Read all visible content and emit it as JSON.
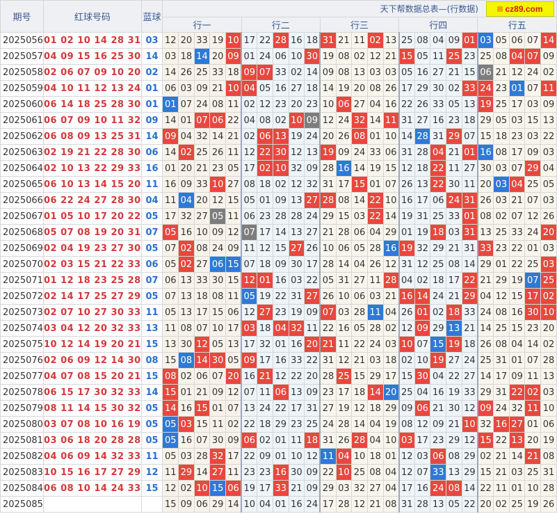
{
  "header": {
    "issue_label": "期号",
    "red_label": "红球号码",
    "blue_label": "蓝球",
    "banner": "天下帮数据总表—(行数据)",
    "logo_text": "cz89.com",
    "groups": [
      "行一",
      "行二",
      "行三",
      "行四",
      "行五"
    ]
  },
  "colors": {
    "red": "#e8473f",
    "blue": "#2f79d6",
    "gray": "#7d7d7d",
    "red_text": "#d03a3a",
    "blue_text": "#2a6fcb"
  },
  "rows": [
    {
      "issue": "2025056",
      "reds": "01 02 10 14 28 31",
      "blue": "03",
      "nums": [
        "12",
        "20",
        "33",
        "19",
        "10",
        "17",
        "22",
        "28",
        "16",
        "18",
        "31",
        "21",
        "11",
        "02",
        "13",
        "25",
        "08",
        "04",
        "09",
        "01",
        "03",
        "05",
        "06",
        "07",
        "14"
      ],
      "hl": "....R..R..R..R.....RB...R"
    },
    {
      "issue": "2025057",
      "reds": "04 09 15 16 25 30",
      "blue": "14",
      "nums": [
        "03",
        "18",
        "14",
        "20",
        "09",
        "01",
        "24",
        "06",
        "10",
        "30",
        "19",
        "08",
        "02",
        "12",
        "21",
        "15",
        "05",
        "11",
        "25",
        "23",
        "25",
        "08",
        "04",
        "07",
        "09"
      ],
      "hl": "..B.R....R.....R..R...RR."
    },
    {
      "issue": "2025058",
      "reds": "02 06 07 09 10 20",
      "blue": "02",
      "nums": [
        "14",
        "26",
        "25",
        "33",
        "18",
        "09",
        "07",
        "33",
        "02",
        "14",
        "09",
        "08",
        "13",
        "03",
        "03",
        "05",
        "16",
        "27",
        "21",
        "15",
        "06",
        "21",
        "12",
        "24",
        "02"
      ],
      "hl": ".....RR.............G...."
    },
    {
      "issue": "2025059",
      "reds": "04 10 11 12 13 24",
      "blue": "01",
      "nums": [
        "06",
        "03",
        "09",
        "21",
        "10",
        "04",
        "05",
        "16",
        "27",
        "18",
        "14",
        "19",
        "20",
        "08",
        "26",
        "17",
        "29",
        "30",
        "02",
        "33",
        "24",
        "23",
        "01",
        "07",
        "11"
      ],
      "hl": "....RR.............RR.B.R"
    },
    {
      "issue": "2025060",
      "reds": "06 14 18 25 28 30",
      "blue": "01",
      "nums": [
        "01",
        "07",
        "24",
        "08",
        "11",
        "02",
        "12",
        "23",
        "20",
        "23",
        "10",
        "06",
        "27",
        "04",
        "16",
        "22",
        "26",
        "33",
        "05",
        "13",
        "19",
        "25",
        "17",
        "03",
        "09"
      ],
      "hl": "B..........R........R...."
    },
    {
      "issue": "2025061",
      "reds": "06 07 09 10 11 32",
      "blue": "09",
      "nums": [
        "14",
        "01",
        "07",
        "06",
        "22",
        "04",
        "08",
        "02",
        "10",
        "09",
        "12",
        "24",
        "32",
        "14",
        "11",
        "31",
        "27",
        "16",
        "23",
        "18",
        "29",
        "05",
        "03",
        "15",
        "13"
      ],
      "hl": "..RR....RG..R.R.........."
    },
    {
      "issue": "2025062",
      "reds": "06 08 09 13 25 31",
      "blue": "14",
      "nums": [
        "09",
        "04",
        "32",
        "14",
        "21",
        "02",
        "06",
        "13",
        "19",
        "24",
        "20",
        "26",
        "08",
        "01",
        "10",
        "14",
        "28",
        "31",
        "29",
        "07",
        "15",
        "18",
        "23",
        "03",
        "22"
      ],
      "hl": "R.....RR....R...B.R......"
    },
    {
      "issue": "2025063",
      "reds": "02 19 21 22 28 30",
      "blue": "06",
      "nums": [
        "14",
        "02",
        "25",
        "26",
        "11",
        "12",
        "22",
        "30",
        "12",
        "13",
        "19",
        "09",
        "24",
        "33",
        "06",
        "31",
        "28",
        "04",
        "21",
        "01",
        "16",
        "08",
        "17",
        "09",
        "03"
      ],
      "hl": ".R....RR..R......R.RB...."
    },
    {
      "issue": "2025064",
      "reds": "02 10 13 22 29 33",
      "blue": "16",
      "nums": [
        "01",
        "20",
        "21",
        "23",
        "05",
        "17",
        "02",
        "10",
        "32",
        "09",
        "28",
        "16",
        "14",
        "19",
        "15",
        "12",
        "18",
        "22",
        "11",
        "27",
        "30",
        "03",
        "07",
        "29",
        "04"
      ],
      "hl": "......RR...B.....R.....R."
    },
    {
      "issue": "2025065",
      "reds": "06 10 13 14 15 20",
      "blue": "11",
      "nums": [
        "16",
        "09",
        "33",
        "10",
        "27",
        "08",
        "18",
        "02",
        "12",
        "32",
        "31",
        "17",
        "15",
        "01",
        "07",
        "26",
        "13",
        "22",
        "30",
        "11",
        "20",
        "03",
        "04",
        "25",
        "05"
      ],
      "hl": "...R........R....R...BR.."
    },
    {
      "issue": "2025066",
      "reds": "06 22 24 27 28 30",
      "blue": "04",
      "nums": [
        "11",
        "04",
        "20",
        "12",
        "15",
        "05",
        "01",
        "09",
        "13",
        "27",
        "28",
        "08",
        "14",
        "22",
        "10",
        "16",
        "17",
        "06",
        "24",
        "31",
        "26",
        "03",
        "21",
        "07",
        "03"
      ],
      "hl": ".B.......RR..R....RR....."
    },
    {
      "issue": "2025067",
      "reds": "01 05 10 17 20 22",
      "blue": "05",
      "nums": [
        "17",
        "32",
        "27",
        "05",
        "11",
        "06",
        "23",
        "28",
        "28",
        "24",
        "29",
        "15",
        "03",
        "22",
        "14",
        "19",
        "31",
        "25",
        "33",
        "01",
        "08",
        "02",
        "07",
        "12",
        "26"
      ],
      "hl": "...G.........R.....R....."
    },
    {
      "issue": "2025068",
      "reds": "05 07 08 19 20 31",
      "blue": "07",
      "nums": [
        "05",
        "16",
        "10",
        "09",
        "12",
        "07",
        "17",
        "14",
        "13",
        "27",
        "21",
        "28",
        "06",
        "04",
        "29",
        "01",
        "19",
        "18",
        "03",
        "31",
        "13",
        "25",
        "33",
        "24",
        "20"
      ],
      "hl": "R....G...........R.R....R"
    },
    {
      "issue": "2025069",
      "reds": "02 04 19 23 27 30",
      "blue": "05",
      "nums": [
        "07",
        "02",
        "08",
        "24",
        "09",
        "11",
        "12",
        "15",
        "27",
        "26",
        "10",
        "06",
        "05",
        "28",
        "16",
        "19",
        "32",
        "29",
        "21",
        "31",
        "33",
        "23",
        "22",
        "01",
        "03"
      ],
      "hl": ".R......R.....BR....R...."
    },
    {
      "issue": "2025070",
      "reds": "02 03 15 21 22 33",
      "blue": "06",
      "nums": [
        "05",
        "02",
        "27",
        "06",
        "15",
        "07",
        "18",
        "09",
        "30",
        "17",
        "28",
        "14",
        "04",
        "26",
        "12",
        "31",
        "12",
        "25",
        "08",
        "14",
        "29",
        "01",
        "22",
        "25",
        "03"
      ],
      "hl": ".R.BB...................R"
    },
    {
      "issue": "2025071",
      "reds": "01 12 18 23 25 28",
      "blue": "07",
      "nums": [
        "06",
        "13",
        "33",
        "30",
        "15",
        "12",
        "01",
        "16",
        "03",
        "22",
        "05",
        "31",
        "27",
        "11",
        "28",
        "04",
        "02",
        "18",
        "17",
        "22",
        "21",
        "29",
        "19",
        "07",
        "25"
      ],
      "hl": ".....RR.......R....R...BR"
    },
    {
      "issue": "2025072",
      "reds": "02 14 17 25 27 29",
      "blue": "05",
      "nums": [
        "07",
        "13",
        "18",
        "08",
        "11",
        "05",
        "19",
        "22",
        "31",
        "27",
        "26",
        "10",
        "06",
        "03",
        "21",
        "16",
        "14",
        "24",
        "21",
        "29",
        "04",
        "12",
        "15",
        "17",
        "02"
      ],
      "hl": ".....B...R.....RR..R...RR"
    },
    {
      "issue": "2025073",
      "reds": "02 07 10 27 30 33",
      "blue": "11",
      "nums": [
        "05",
        "13",
        "17",
        "15",
        "06",
        "12",
        "27",
        "23",
        "19",
        "09",
        "07",
        "03",
        "28",
        "11",
        "04",
        "26",
        "01",
        "02",
        "18",
        "33",
        "24",
        "08",
        "16",
        "30",
        "10"
      ],
      "hl": "......R...R..B..R.R....RR"
    },
    {
      "issue": "2025074",
      "reds": "03 04 12 20 32 33",
      "blue": "13",
      "nums": [
        "11",
        "08",
        "07",
        "10",
        "17",
        "03",
        "18",
        "04",
        "32",
        "11",
        "22",
        "16",
        "05",
        "28",
        "02",
        "12",
        "09",
        "29",
        "13",
        "21",
        "14",
        "25",
        "15",
        "23",
        "20"
      ],
      "hl": ".....R.RR.......R.B......"
    },
    {
      "issue": "2025075",
      "reds": "10 12 14 19 20 21",
      "blue": "15",
      "nums": [
        "13",
        "30",
        "12",
        "05",
        "13",
        "17",
        "32",
        "01",
        "16",
        "20",
        "21",
        "11",
        "22",
        "24",
        "03",
        "10",
        "07",
        "15",
        "19",
        "18",
        "26",
        "08",
        "04",
        "14",
        "02"
      ],
      "hl": "..R......RR....R.BR......"
    },
    {
      "issue": "2025076",
      "reds": "02 06 09 12 14 30",
      "blue": "08",
      "nums": [
        "15",
        "08",
        "14",
        "30",
        "05",
        "09",
        "17",
        "16",
        "33",
        "22",
        "31",
        "12",
        "21",
        "03",
        "18",
        "02",
        "10",
        "19",
        "27",
        "24",
        "25",
        "31",
        "01",
        "07",
        "28"
      ],
      "hl": ".BRR.R...........R......."
    },
    {
      "issue": "2025077",
      "reds": "04 07 08 15 20 21",
      "blue": "15",
      "nums": [
        "08",
        "02",
        "06",
        "07",
        "20",
        "16",
        "21",
        "12",
        "22",
        "20",
        "28",
        "25",
        "15",
        "29",
        "17",
        "15",
        "30",
        "04",
        "22",
        "27",
        "14",
        "17",
        "09",
        "11",
        "13"
      ],
      "hl": "R...R.R....R....R........"
    },
    {
      "issue": "2025078",
      "reds": "06 15 17 30 32 33",
      "blue": "14",
      "nums": [
        "15",
        "01",
        "21",
        "09",
        "12",
        "07",
        "11",
        "06",
        "13",
        "09",
        "23",
        "17",
        "18",
        "14",
        "20",
        "25",
        "04",
        "16",
        "19",
        "33",
        "29",
        "31",
        "22",
        "02",
        "03"
      ],
      "hl": "R......R.....RB.......RR."
    },
    {
      "issue": "2025079",
      "reds": "08 11 14 15 30 32",
      "blue": "05",
      "nums": [
        "14",
        "16",
        "15",
        "01",
        "07",
        "13",
        "24",
        "22",
        "17",
        "31",
        "27",
        "19",
        "12",
        "18",
        "29",
        "09",
        "06",
        "21",
        "30",
        "12",
        "09",
        "24",
        "32",
        "11",
        "10"
      ],
      "hl": "R.R.............R...R..R."
    },
    {
      "issue": "2025080",
      "reds": "03 07 08 10 16 19",
      "blue": "05",
      "nums": [
        "05",
        "03",
        "15",
        "11",
        "02",
        "22",
        "18",
        "29",
        "23",
        "25",
        "24",
        "28",
        "14",
        "04",
        "19",
        "08",
        "12",
        "09",
        "21",
        "10",
        "32",
        "16",
        "27",
        "01",
        "06"
      ],
      "hl": "BR.................R.RR.."
    },
    {
      "issue": "2025081",
      "reds": "03 06 18 20 28 28",
      "blue": "05",
      "nums": [
        "05",
        "16",
        "07",
        "30",
        "09",
        "06",
        "02",
        "01",
        "11",
        "18",
        "31",
        "26",
        "28",
        "04",
        "10",
        "03",
        "17",
        "23",
        "29",
        "12",
        "15",
        "22",
        "13",
        "20",
        "19"
      ],
      "hl": "B....R...R..R..R....R.R.."
    },
    {
      "issue": "2025082",
      "reds": "04 06 09 14 32 33",
      "blue": "11",
      "nums": [
        "05",
        "03",
        "28",
        "32",
        "17",
        "22",
        "09",
        "01",
        "10",
        "12",
        "11",
        "04",
        "10",
        "18",
        "01",
        "12",
        "03",
        "06",
        "08",
        "29",
        "02",
        "21",
        "14",
        "21",
        "08"
      ],
      "hl": "...R......BR.....R.....R."
    },
    {
      "issue": "2025083",
      "reds": "10 15 16 17 27 29",
      "blue": "12",
      "nums": [
        "11",
        "29",
        "14",
        "27",
        "11",
        "23",
        "23",
        "16",
        "30",
        "09",
        "22",
        "10",
        "25",
        "08",
        "04",
        "12",
        "07",
        "33",
        "13",
        "29",
        "15",
        "21",
        "03",
        "25",
        "31"
      ],
      "hl": ".R.R...R...R.....B.......",
      "alt": true
    },
    {
      "issue": "2025084",
      "reds": "06 08 10 14 24 33",
      "blue": "15",
      "nums": [
        "12",
        "02",
        "10",
        "15",
        "06",
        "19",
        "17",
        "33",
        "21",
        "09",
        "29",
        "03",
        "32",
        "27",
        "04",
        "17",
        "16",
        "24",
        "08",
        "14",
        "22",
        "11",
        "01",
        "10",
        "28"
      ],
      "hl": "..RBR..R.........RR......"
    },
    {
      "issue": "2025085",
      "reds": "",
      "blue": "",
      "nums": [
        "15",
        "09",
        "06",
        "29",
        "14",
        "10",
        "04",
        "01",
        "16",
        "24",
        "17",
        "28",
        "12",
        "21",
        "08",
        "31",
        "28",
        "13",
        "05",
        "22",
        "20",
        "02",
        "25",
        "19",
        "26"
      ],
      "hl": "........................."
    }
  ]
}
